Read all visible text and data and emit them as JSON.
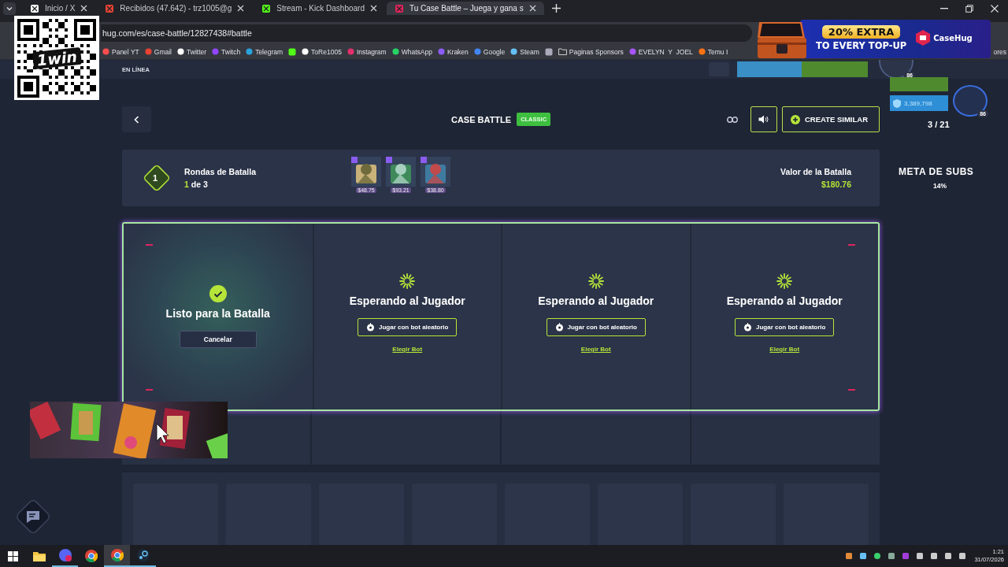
{
  "browser": {
    "tabs": [
      {
        "title": "Inicio / X",
        "selected": false
      },
      {
        "title": "Recibidos (47.642) - trz1005@g",
        "selected": false
      },
      {
        "title": "Stream - Kick Dashboard",
        "selected": false
      },
      {
        "title": "Tu Case Battle – Juega y gana s",
        "selected": true
      }
    ],
    "address": "hug.com/es/case-battle/12827438#battle",
    "bookmarks": [
      {
        "kind": "link",
        "label": "Panel YT"
      },
      {
        "kind": "link",
        "label": "Gmail"
      },
      {
        "kind": "link",
        "label": "Twitter"
      },
      {
        "kind": "link",
        "label": "Twitch"
      },
      {
        "kind": "link",
        "label": "Telegram"
      },
      {
        "kind": "icon"
      },
      {
        "kind": "link",
        "label": "ToRe1005"
      },
      {
        "kind": "link",
        "label": "Instagram"
      },
      {
        "kind": "link",
        "label": "WhatsApp"
      },
      {
        "kind": "link",
        "label": "Kraken"
      },
      {
        "kind": "link",
        "label": "Google"
      },
      {
        "kind": "link",
        "label": "Steam"
      },
      {
        "kind": "icon"
      },
      {
        "kind": "folder",
        "label": "Paginas Sponsors"
      },
      {
        "kind": "link",
        "label": "EVELYN  Y  JOEL"
      },
      {
        "kind": "link",
        "label": "Temu I"
      }
    ],
    "other_bookmarks": "ores"
  },
  "site_header": {
    "status": "EN LÍNEA",
    "badge": "86"
  },
  "battle": {
    "title": "CASE BATTLE",
    "mode": "CLASSIC",
    "create_button": "CREATE SIMILAR",
    "round_badge": "1",
    "rounds_label": "Rondas de Batalla",
    "round_current": "1",
    "round_total": "de 3",
    "cases": [
      {
        "price": "$48.75"
      },
      {
        "price": "$93.21"
      },
      {
        "price": "$38.80"
      }
    ],
    "value_label": "Valor de la Batalla",
    "value": "$180.76",
    "slots": [
      {
        "kind": "ready",
        "title": "Listo para la Batalla",
        "button": "Cancelar"
      },
      {
        "kind": "waiting",
        "title": "Esperando al Jugador",
        "button": "Jugar con bot aleatorio",
        "link": "Elegir Bot"
      },
      {
        "kind": "waiting",
        "title": "Esperando al Jugador",
        "button": "Jugar con bot aleatorio",
        "link": "Elegir Bot"
      },
      {
        "kind": "waiting",
        "title": "Esperando al Jugador",
        "button": "Jugar con bot aleatorio",
        "link": "Elegir Bot"
      }
    ]
  },
  "qr_overlay": {
    "brand": "1win"
  },
  "ad_banner": {
    "headline": "20% EXTRA",
    "subline": "TO EVERY TOP-UP",
    "brand": "CaseHug"
  },
  "stream_widget": {
    "coins": "3,389,798",
    "badge": "86",
    "counter": "3 / 21",
    "goal_title": "META DE SUBS",
    "goal_value": "14%"
  },
  "taskbar": {
    "time": "1:21",
    "date": "31/07/2026"
  }
}
